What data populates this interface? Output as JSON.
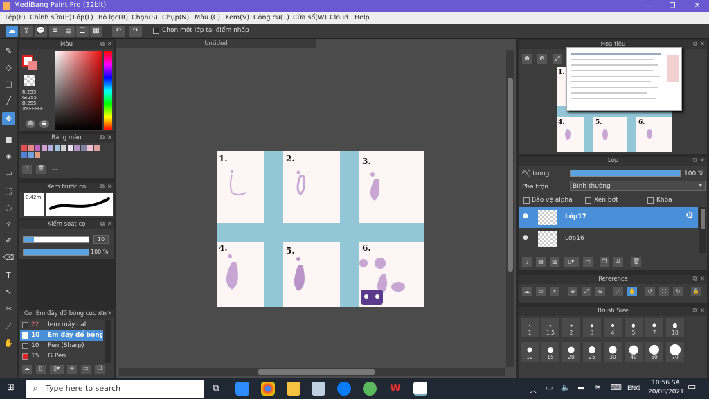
{
  "window": {
    "title": "MediBang Paint Pro (32bit)"
  },
  "menu": [
    "Tệp(F)",
    "Chỉnh sửa(E)",
    "Lớp(L)",
    "Bộ lọc(R)",
    "Chọn(S)",
    "Chụp(N)",
    "Màu (C)",
    "Xem(V)",
    "Công cụ(T)",
    "Cửa sổ(W)",
    "Cloud",
    "Help"
  ],
  "toolbar": {
    "checkbox_label": "Chọn một lớp tại điểm nhấp"
  },
  "color_panel": {
    "title": "Màu",
    "r": "R:255",
    "g": "G:255",
    "b": "B:255",
    "hex": "#FFFFFF"
  },
  "palette_panel": {
    "title": "Bảng màu",
    "more": "---",
    "colors": [
      "#e05050",
      "#e88a8a",
      "#c060c0",
      "#d0a0d0",
      "#b0b0e0",
      "#a0c0e0",
      "#d0d0d0",
      "#e8e0f0",
      "#b090c0",
      "#8080a0",
      "#f0c0d0",
      "#e0a0a0",
      "#5080d0",
      "#70a0e0",
      "#e0a080"
    ]
  },
  "brush_preview": {
    "title": "Xem trước cọ",
    "size": "0.42m"
  },
  "brush_control": {
    "title": "Kiểm soát cọ",
    "size_value": "10",
    "opacity_value": "100 %",
    "opacity": 1.0
  },
  "brush_list": {
    "title": "Cọ: Em đây đổ bóng cực xịn",
    "items": [
      {
        "size": "22",
        "name": "Iem mây cali okee",
        "color": "#e04040"
      },
      {
        "size": "10",
        "name": "Em đây đổ bóng",
        "color": "#ffffff"
      },
      {
        "size": "10",
        "name": "Pen (Sharp)",
        "color": "#333333"
      },
      {
        "size": "15",
        "name": "G Pen",
        "color": "#e02020"
      }
    ]
  },
  "document": {
    "tab": "Untitled",
    "labels": [
      "1.",
      "2.",
      "3.",
      "4.",
      "5.",
      "6."
    ]
  },
  "navigator": {
    "title": "Hoa tiêu",
    "labels": [
      "1.",
      "4.",
      "5.",
      "6."
    ]
  },
  "layer_panel": {
    "title": "Lớp",
    "opacity_label": "Độ trong",
    "opacity_value": "100 %",
    "opacity": 1.0,
    "blend_label": "Pha trộn",
    "blend_value": "Bình thường",
    "protect_alpha": "Bảo vệ alpha",
    "clip": "Xén bớt",
    "lock": "Khóa",
    "layers": [
      "Lớp17",
      "Lớp16"
    ]
  },
  "reference_panel": {
    "title": "Reference"
  },
  "brush_size_panel": {
    "title": "Brush Size",
    "sizes_row1": [
      "1",
      "1.5",
      "2",
      "3",
      "4",
      "5",
      "7",
      "10"
    ],
    "sizes_row2": [
      "12",
      "15",
      "20",
      "25",
      "30",
      "40",
      "50",
      "70"
    ]
  },
  "taskbar": {
    "search_placeholder": "Type here to search",
    "lang": "ENG",
    "time": "10:56 SA",
    "date": "20/08/2021"
  },
  "accent": "#4a90d9"
}
